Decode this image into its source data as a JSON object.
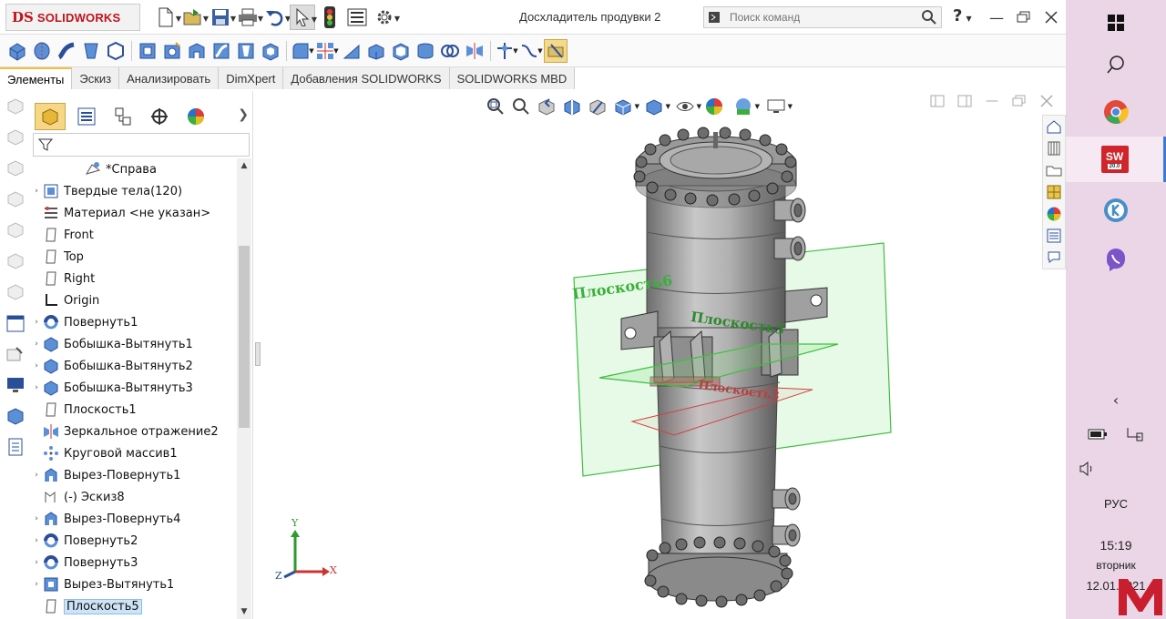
{
  "app": {
    "logo_ds": "DS",
    "logo_name": "SOLIDWORKS",
    "document_title": "Досхладитель продувки 2",
    "search_placeholder": "Поиск команд",
    "help_label": "?"
  },
  "tabs": [
    {
      "label": "Элементы",
      "active": true
    },
    {
      "label": "Эскиз",
      "active": false
    },
    {
      "label": "Анализировать",
      "active": false
    },
    {
      "label": "DimXpert",
      "active": false
    },
    {
      "label": "Добавления SOLIDWORKS",
      "active": false
    },
    {
      "label": "SOLIDWORKS MBD",
      "active": false
    }
  ],
  "feature_tree": {
    "root_label": "*Справа",
    "items": [
      {
        "label": "Твердые тела(120)",
        "icon": "solid-bodies-icon",
        "expandable": true
      },
      {
        "label": "Материал <не указан>",
        "icon": "material-icon",
        "expandable": false
      },
      {
        "label": "Front",
        "icon": "plane-icon",
        "expandable": false
      },
      {
        "label": "Top",
        "icon": "plane-icon",
        "expandable": false
      },
      {
        "label": "Right",
        "icon": "plane-icon",
        "expandable": false
      },
      {
        "label": "Origin",
        "icon": "origin-icon",
        "expandable": false
      },
      {
        "label": "Повернуть1",
        "icon": "revolve-icon",
        "expandable": true
      },
      {
        "label": "Бобышка-Вытянуть1",
        "icon": "extrude-icon",
        "expandable": true
      },
      {
        "label": "Бобышка-Вытянуть2",
        "icon": "extrude-icon",
        "expandable": true
      },
      {
        "label": "Бобышка-Вытянуть3",
        "icon": "extrude-icon",
        "expandable": true
      },
      {
        "label": "Плоскость1",
        "icon": "plane-icon",
        "expandable": false
      },
      {
        "label": "Зеркальное отражение2",
        "icon": "mirror-icon",
        "expandable": false
      },
      {
        "label": "Круговой массив1",
        "icon": "circular-pattern-icon",
        "expandable": false
      },
      {
        "label": "Вырез-Повернуть1",
        "icon": "cut-revolve-icon",
        "expandable": true
      },
      {
        "label": "(-) Эскиз8",
        "icon": "sketch-icon",
        "expandable": false
      },
      {
        "label": "Вырез-Повернуть4",
        "icon": "cut-revolve-icon",
        "expandable": true
      },
      {
        "label": "Повернуть2",
        "icon": "revolve-icon",
        "expandable": true
      },
      {
        "label": "Повернуть3",
        "icon": "revolve-icon",
        "expandable": true
      },
      {
        "label": "Вырез-Вытянуть1",
        "icon": "cut-extrude-icon",
        "expandable": true
      },
      {
        "label": "Плоскость5",
        "icon": "plane-icon",
        "expandable": false,
        "selected": true
      }
    ]
  },
  "viewport": {
    "plane_labels": [
      "Плоскость6",
      "Плоскость5",
      "Плоскость3"
    ],
    "triad": {
      "x": "X",
      "y": "Y",
      "z": "Z"
    }
  },
  "taskbar": {
    "language": "РУС",
    "time": "15:19",
    "weekday": "вторник",
    "date": "12.01.2021",
    "sw_badge": "20.0"
  },
  "colors": {
    "accent_tab": "#f0c040",
    "selection": "#cde4f7",
    "plane_green": "#3fbf3f",
    "plane_red": "#d04040",
    "taskbar_bg": "#ead6e6"
  }
}
